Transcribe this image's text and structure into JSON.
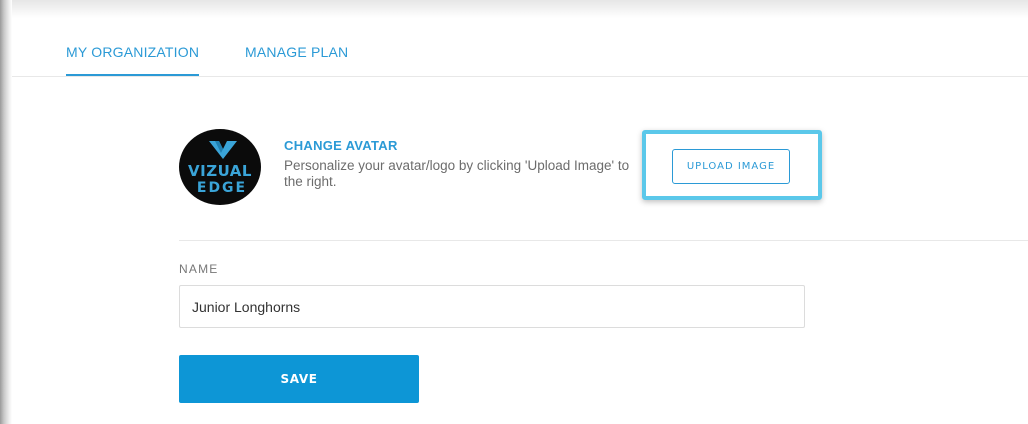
{
  "tabs": [
    {
      "label": "MY ORGANIZATION",
      "active": true
    },
    {
      "label": "MANAGE PLAN",
      "active": false
    }
  ],
  "avatar": {
    "logo_line1": "VIZUAL",
    "logo_line2": "EDGE",
    "title": "CHANGE AVATAR",
    "description": "Personalize your avatar/logo by clicking 'Upload Image' to the right.",
    "upload_label": "UPLOAD IMAGE"
  },
  "form": {
    "name_label": "NAME",
    "name_value": "Junior Longhorns",
    "save_label": "SAVE"
  },
  "colors": {
    "accent": "#2b9ad6",
    "highlight": "#5bc8ea",
    "save_bg": "#0d96d6"
  }
}
